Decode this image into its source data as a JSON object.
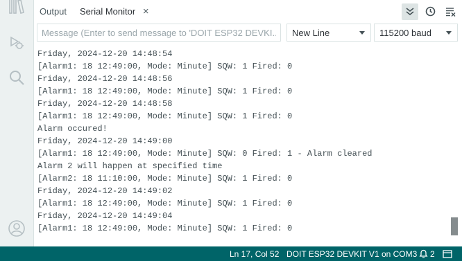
{
  "tabs": {
    "output_label": "Output",
    "serial_label": "Serial Monitor",
    "close_glyph": "×"
  },
  "toolbar": {
    "message_placeholder": "Message (Enter to send message to 'DOIT ESP32 DEVKI...",
    "line_ending": "New Line",
    "baud_rate": "115200 baud"
  },
  "output_lines": [
    "Friday, 2024-12-20 14:48:54",
    "[Alarm1: 18 12:49:00, Mode: Minute] SQW: 1 Fired: 0",
    "Friday, 2024-12-20 14:48:56",
    "[Alarm1: 18 12:49:00, Mode: Minute] SQW: 1 Fired: 0",
    "Friday, 2024-12-20 14:48:58",
    "[Alarm1: 18 12:49:00, Mode: Minute] SQW: 1 Fired: 0",
    "Alarm occured!",
    "Friday, 2024-12-20 14:49:00",
    "[Alarm1: 18 12:49:00, Mode: Minute] SQW: 0 Fired: 1 - Alarm cleared",
    "Alarm 2 will happen at specified time",
    "[Alarm2: 18 11:10:00, Mode: Minute] SQW: 1 Fired: 0",
    "Friday, 2024-12-20 14:49:02",
    "[Alarm1: 18 12:49:00, Mode: Minute] SQW: 1 Fired: 0",
    "Friday, 2024-12-20 14:49:04",
    "[Alarm1: 18 12:49:00, Mode: Minute] SQW: 1 Fired: 0"
  ],
  "statusbar": {
    "cursor_position": "Ln 17, Col 52",
    "board_port": "DOIT ESP32 DEVKIT V1 on COM3",
    "notification_count": "2"
  },
  "icons": {
    "activity": [
      "library-icon",
      "debug-icon",
      "search-icon",
      "account-icon"
    ],
    "toolbar": [
      "autoscroll-icon",
      "timestamp-icon",
      "clear-output-icon"
    ],
    "status": [
      "notification-icon",
      "terminal-icon"
    ]
  },
  "colors": {
    "statusbar_bg": "#006468",
    "activity_bar_bg": "#ecf1f1",
    "text": "#434f54"
  }
}
